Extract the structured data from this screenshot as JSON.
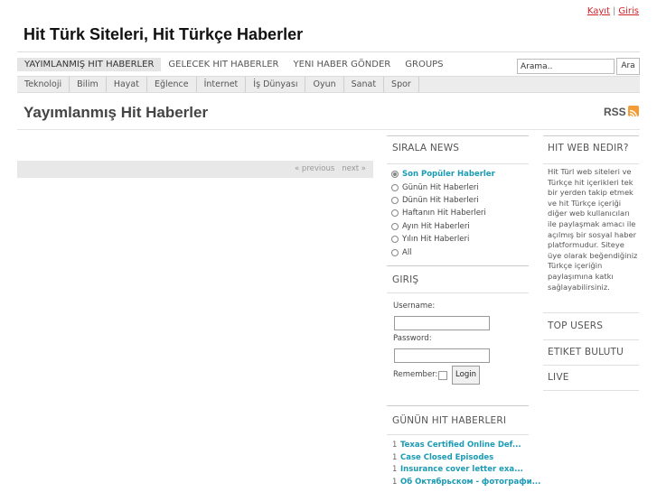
{
  "top_links": {
    "register": "Kayıt",
    "separator": "|",
    "login": "Giris"
  },
  "site_title": "Hit Türk Siteleri, Hit Türkçe Haberler",
  "main_nav": [
    {
      "label": "YAYIMLANMIŞ HIT HABERLER",
      "active": true
    },
    {
      "label": "GELECEK HIT HABERLER",
      "active": false
    },
    {
      "label": "YENI HABER GÖNDER",
      "active": false
    },
    {
      "label": "GROUPS",
      "active": false
    }
  ],
  "search": {
    "value": "Arama..",
    "button": "Ara"
  },
  "categories": [
    "Teknoloji",
    "Bilim",
    "Hayat",
    "Eğlence",
    "İnternet",
    "İş Dünyası",
    "Oyun",
    "Sanat",
    "Spor"
  ],
  "page_title": "Yayımlanmış Hit Haberler",
  "rss_label": "RSS",
  "pager": {
    "previous": "« previous",
    "next": "next »"
  },
  "sirala": {
    "heading": "SIRALA NEWS",
    "options": [
      {
        "label": "Son Popüler Haberler",
        "selected": true
      },
      {
        "label": "Günün Hit Haberleri",
        "selected": false
      },
      {
        "label": "Dünün Hit Haberleri",
        "selected": false
      },
      {
        "label": "Haftanın Hit Haberleri",
        "selected": false
      },
      {
        "label": "Ayın Hit Haberleri",
        "selected": false
      },
      {
        "label": "Yılın Hit Haberleri",
        "selected": false
      },
      {
        "label": "All",
        "selected": false
      }
    ]
  },
  "login_box": {
    "heading": "GIRIŞ",
    "username_label": "Username:",
    "password_label": "Password:",
    "remember_label": "Remember:",
    "button": "Login"
  },
  "gunun": {
    "heading": "GÜNÜN HIT HABERLERI",
    "items": [
      {
        "num": "1",
        "title": "Texas Certified Online Def..."
      },
      {
        "num": "1",
        "title": "Case Closed Episodes"
      },
      {
        "num": "1",
        "title": "Insurance cover letter exa..."
      },
      {
        "num": "1",
        "title": "Об Октябрьском - фотографи..."
      }
    ]
  },
  "hit_web": {
    "heading": "HIT WEB NEDIR?",
    "text": "Hit Türl web siteleri ve Türkçe hit içerikleri tek bir yerden takip etmek ve hit Türkçe içeriği diğer web kullanıcıları ile paylaşmak amacı ile açılmış bir sosyal haber platformudur. Siteye üye olarak beğendiğiniz Türkçe içeriğin paylaşımına katkı sağlayabilirsiniz."
  },
  "right_links": {
    "top_users": "TOP USERS",
    "etiket": "ETIKET BULUTU",
    "live": "LIVE"
  },
  "colors": {
    "link_accent": "#1a9ab3",
    "top_link_red": "#d2232a",
    "rss_orange": "#f39c36"
  },
  "icons": {
    "rss": "rss-icon"
  }
}
